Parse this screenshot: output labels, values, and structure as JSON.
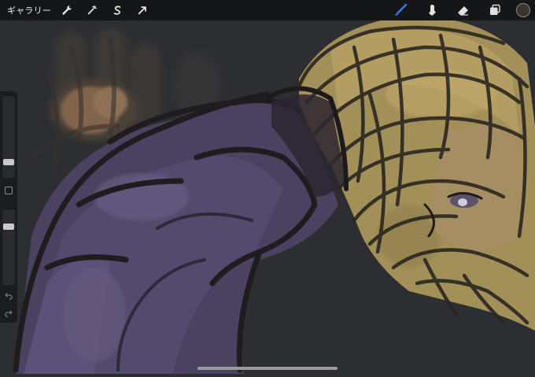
{
  "toolbar": {
    "gallery_label": "ギャラリー",
    "left_icons": [
      "wrench-icon",
      "magic-wand-icon",
      "selection-s-icon",
      "transform-arrow-icon"
    ],
    "right_icons": [
      "brush-icon",
      "smudge-icon",
      "eraser-icon",
      "layers-icon"
    ],
    "active_tool": "brush-icon",
    "accent_color": "#3a7bff",
    "current_color": "#3a3330"
  },
  "sidebar": {
    "brush_size_fraction": 0.17,
    "opacity_fraction": 0.79
  },
  "canvas": {
    "background": "#2c2e32"
  }
}
